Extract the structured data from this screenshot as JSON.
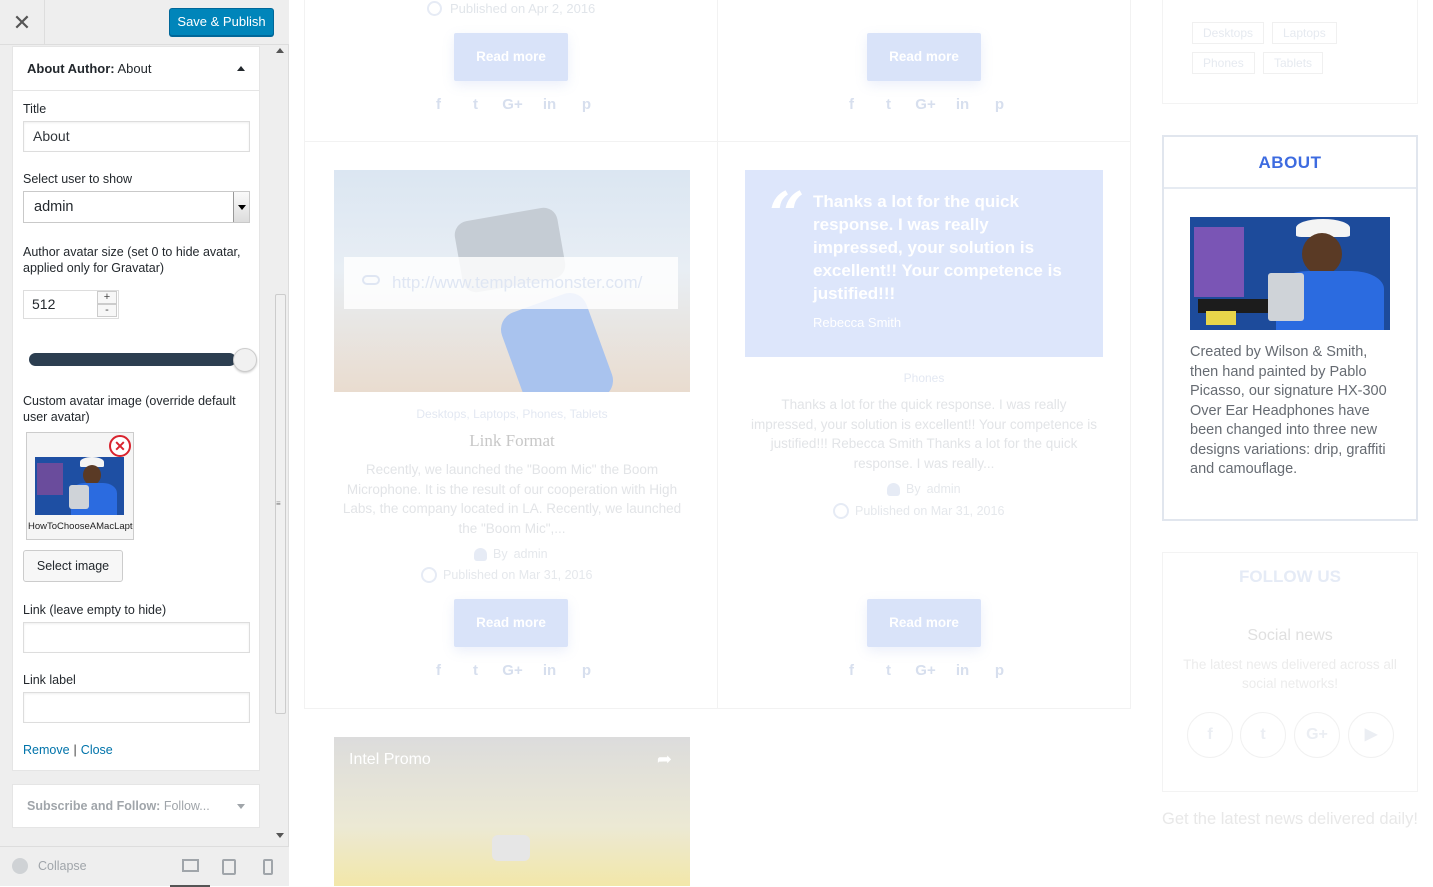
{
  "header": {
    "close_glyph": "✕",
    "publish_label": "Save & Publish"
  },
  "widget": {
    "title_prefix": "About Author:",
    "title_suffix": "About",
    "title_label": "Title",
    "title_value": "About",
    "select_user_label": "Select user to show",
    "select_user_value": "admin",
    "avatar_size_label": "Author avatar size (set 0 to hide avatar, applied only for Gravatar)",
    "avatar_size_value": "512",
    "avatar_slider_fraction": 1.0,
    "custom_avatar_label": "Custom avatar image (override default user avatar)",
    "thumb_caption": "HowToChooseAMacLaptop",
    "select_image_label": "Select image",
    "link_label": "Link (leave empty to hide)",
    "link_value": "",
    "link_label_label": "Link label",
    "link_label_value": "",
    "remove_label": "Remove",
    "separator": "|",
    "close_label": "Close"
  },
  "subscribe": {
    "title_prefix": "Subscribe and Follow:",
    "title_suffix": "Follow..."
  },
  "footer": {
    "collapse_label": "Collapse"
  },
  "preview": {
    "top_left_published": "Published on Apr 2, 2016",
    "read_more": "Read more",
    "social_icons": [
      "f",
      "t",
      "G+",
      "in",
      "p"
    ],
    "link_post": {
      "url": "http://www.templatemonster.com/",
      "categories": "Desktops, Laptops, Phones, Tablets",
      "title": "Link Format",
      "excerpt": "Recently, we launched the \"Boom Mic\" the Boom Microphone. It is the result of our cooperation with High Labs, the company located in LA. Recently, we launched the \"Boom Mic\",...",
      "by": "By",
      "author": "admin",
      "published": "Published on Mar 31, 2016"
    },
    "quote_post": {
      "quote_mark": "“",
      "quote": "Thanks a lot for the quick response. I was really impressed, your solution is excellent!! Your competence is justified!!!",
      "author": "Rebecca Smith",
      "category": "Phones",
      "excerpt": "Thanks a lot for the quick response. I was really impressed, your solution is excellent!! Your competence is justified!!! Rebecca Smith Thanks a lot for the quick response. I was really...",
      "by": "By",
      "author_link": "admin",
      "published": "Published on Mar 31, 2016"
    },
    "video_title": "Intel Promo",
    "tags": [
      "Desktops",
      "Laptops",
      "Phones",
      "Tablets"
    ],
    "about_title": "ABOUT",
    "about_text": "Created by Wilson & Smith, then hand painted by Pablo Picasso, our signature HX-300 Over Ear Headphones have been changed into three new designs variations: drip, graffiti and camouflage.",
    "follow_title": "FOLLOW US",
    "social_news": "Social news",
    "social_desc": "The latest news delivered across all social networks!",
    "round_socials": [
      "f",
      "t",
      "G+",
      "▶"
    ],
    "newsletter": "Get the latest news delivered daily!"
  },
  "colors": {
    "primary": "#0085ba",
    "accent_blue": "#3d6be0",
    "slider": "#2c3e50",
    "remove_red": "#d9232e"
  }
}
